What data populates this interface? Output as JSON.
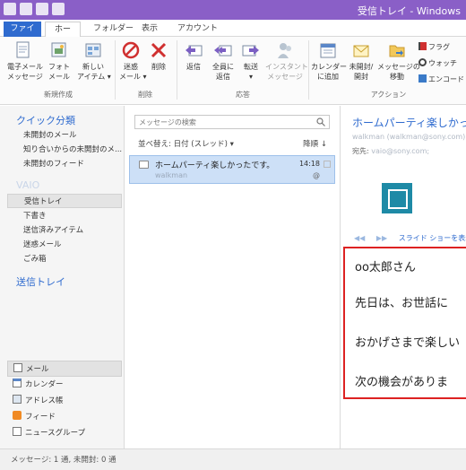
{
  "window": {
    "title": "受信トレイ - Windows"
  },
  "ribbon": {
    "tabs": {
      "file": "ファイル",
      "home": "ホーム",
      "folder": "フォルダー",
      "view": "表示",
      "account": "アカウント"
    },
    "new_group": {
      "email": "電子メール\nメッセージ",
      "photo": "フォト\nメール",
      "new_item": "新しい\nアイテム ▾",
      "label": "新規作成"
    },
    "delete_group": {
      "junk": "迷惑\nメール ▾",
      "delete": "削除",
      "label": "削除"
    },
    "respond_group": {
      "reply": "返信",
      "reply_all": "全員に\n返信",
      "forward": "転送\n▾",
      "im": "インスタント\nメッセージ",
      "label": "応答"
    },
    "action_group": {
      "add_calendar": "カレンダー\nに追加",
      "unread": "未開封/\n開封",
      "move": "メッセージの\n移動",
      "flag": "フラグ",
      "watch": "ウォッチ",
      "encode": "エンコード",
      "label": "アクション"
    }
  },
  "nav": {
    "quick_views": "クイック分類",
    "quick_items": [
      "未開封のメール",
      "知り合いからの未開封のメ...",
      "未開封のフィード"
    ],
    "account": "VAIO",
    "folders": [
      "受信トレイ",
      "下書き",
      "送信済みアイテム",
      "迷惑メール",
      "ごみ箱"
    ],
    "outbox": "送信トレイ",
    "modules": [
      "メール",
      "カレンダー",
      "アドレス帳",
      "フィード",
      "ニュースグループ"
    ]
  },
  "list": {
    "search_placeholder": "メッセージの検索",
    "sort_by": "並べ替え: 日付 (スレッド) ▾",
    "sort_order": "降順 ↓",
    "messages": [
      {
        "subject": "ホームパーティ楽しかったです。",
        "sender": "walkman",
        "time": "14:18"
      }
    ]
  },
  "reading": {
    "subject": "ホームパーティ楽しかっ",
    "from": "walkman (walkman@sony.com)",
    "to_label": "宛先:",
    "to_value": "vaio@sony.com;",
    "slideshow": "スライド ショーを表示",
    "body_lines": [
      "oo太郎さん",
      "先日は、お世話に",
      "おかげさまで楽しい",
      "次の機会がありま"
    ]
  },
  "status": {
    "text": "メッセージ: 1 通, 未開封: 0 通"
  },
  "colors": {
    "titlebar": "#8a5fc7",
    "accent": "#2f6bcf",
    "selection": "#cde0f7",
    "highlight_box": "#dd2222"
  }
}
